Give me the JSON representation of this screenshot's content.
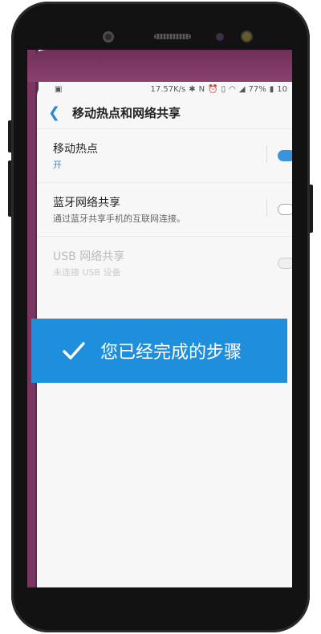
{
  "status": {
    "speed": "17.57K/s",
    "battery": "77%",
    "time_partial": "10"
  },
  "header": {
    "title": "移动热点和网络共享"
  },
  "rows": [
    {
      "label": "移动热点",
      "sub": "开",
      "state": "on"
    },
    {
      "label": "蓝牙网络共享",
      "sub": "通过蓝牙共享手机的互联网连接。",
      "state": "off"
    },
    {
      "label": "USB 网络共享",
      "sub": "未连接 USB 设备",
      "state": "disabled"
    }
  ],
  "banner": {
    "text": "您已经完成的步骤",
    "color": "#1e8fdc"
  }
}
